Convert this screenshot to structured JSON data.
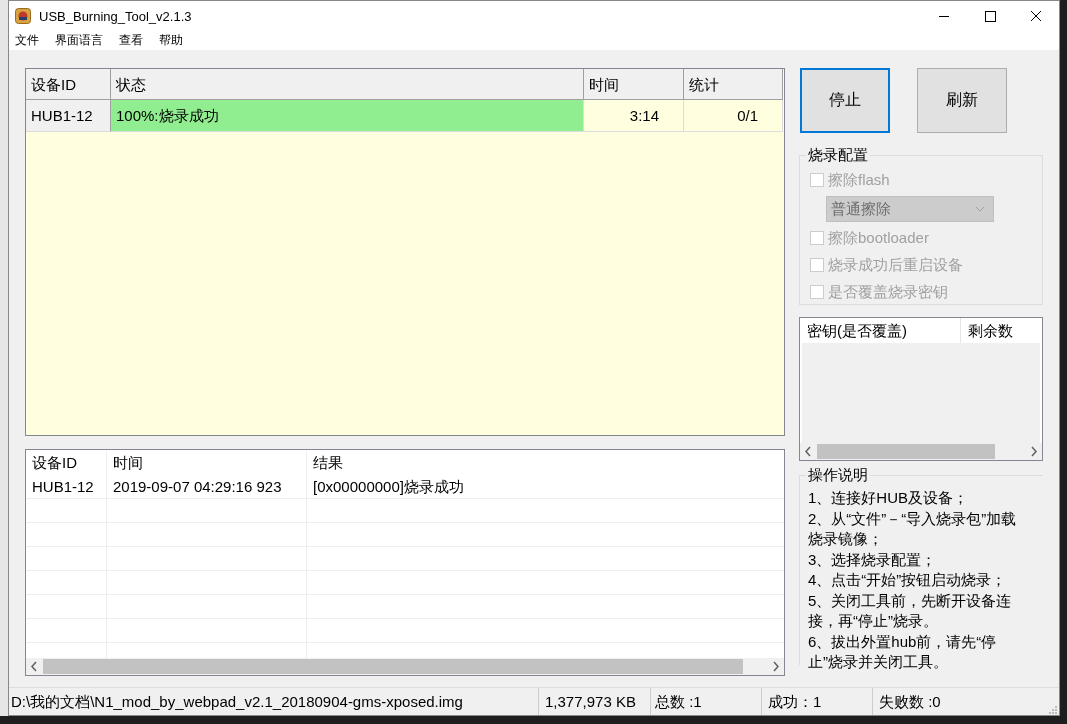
{
  "window": {
    "title": "USB_Burning_Tool_v2.1.3"
  },
  "menu": [
    "文件",
    "界面语言",
    "查看",
    "帮助"
  ],
  "device_table": {
    "columns": [
      "设备ID",
      "状态",
      "时间",
      "统计"
    ],
    "rows": [
      {
        "device": "HUB1-12",
        "status": "100%:烧录成功",
        "level": 1,
        "time": "3:14",
        "count": "0/1"
      }
    ]
  },
  "log_table": {
    "columns": [
      "设备ID",
      "时间",
      "结果"
    ],
    "rows": [
      {
        "device": "HUB1-12",
        "time": "2019-09-07 04:29:16 923",
        "result": "[0x00000000]烧录成功"
      }
    ]
  },
  "buttons": [
    {
      "label": "停止",
      "focused": true
    },
    {
      "label": "刷新",
      "focused": false
    }
  ],
  "burn_config": {
    "title": "烧录配置",
    "options": [
      {
        "kind": "checkbox",
        "label": "擦除flash",
        "checked": false,
        "disabled": true
      },
      {
        "kind": "dropdown",
        "value": "普通擦除",
        "disabled": true
      },
      {
        "kind": "checkbox",
        "label": "擦除bootloader",
        "checked": false,
        "disabled": true
      },
      {
        "kind": "checkbox",
        "label": "烧录成功后重启设备",
        "checked": false,
        "disabled": true
      },
      {
        "kind": "checkbox",
        "label": "是否覆盖烧录密钥",
        "checked": false,
        "disabled": true
      }
    ]
  },
  "key_table": {
    "columns": [
      "密钥(是否覆盖)",
      "剩余数"
    ]
  },
  "instructions": {
    "title": "操作说明",
    "lines": [
      "1、连接好HUB及设备；",
      "2、从“文件”－“导入烧录包”加载烧录镜像；",
      "3、选择烧录配置；",
      "4、点击“开始”按钮启动烧录；",
      "5、关闭工具前，先断开设备连接，再“停止”烧录。",
      "6、拔出外置hub前，请先“停止”烧录并关闭工具。"
    ]
  },
  "status_bar": [
    "D:\\我的文档\\N1_mod_by_webpad_v2.1_20180904-gms-xposed.img",
    "1,377,973 KB",
    "总数 :1",
    "成功：1",
    "失败数 :0"
  ]
}
